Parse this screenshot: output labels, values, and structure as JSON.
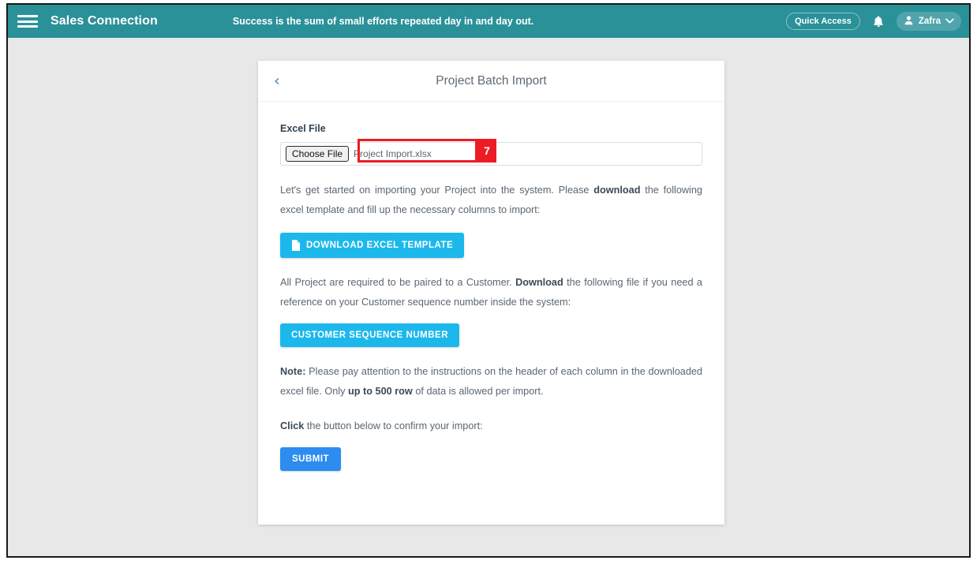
{
  "navbar": {
    "menu_icon": "hamburger-icon",
    "brand": "Sales Connection",
    "tagline": "Success is the sum of small efforts repeated day in and day out.",
    "quick_access_label": "Quick Access",
    "notification_icon": "bell-icon",
    "user_icon": "user-avatar-icon",
    "user_name": "Zafra",
    "user_caret_icon": "chevron-down-icon",
    "background_color": "#2b9199"
  },
  "card": {
    "back_icon": "chevron-left-icon",
    "title": "Project Batch Import"
  },
  "form": {
    "excel_file_label": "Excel File",
    "choose_file_button": "Choose File",
    "file_name": "Project Import.xlsx",
    "annotation_number": "7",
    "annotation_color": "#ed1c24"
  },
  "content": {
    "intro_part1": "Let's get started on importing your Project into the system. Please ",
    "intro_bold": "download",
    "intro_part2": " the following excel template and fill up the necessary columns to import:",
    "download_template_button": "DOWNLOAD EXCEL TEMPLATE",
    "download_template_icon": "file-document-icon",
    "customer_part1": "All Project are required to be paired to a Customer. ",
    "customer_bold": "Download",
    "customer_part2": " the following file if you need a reference on your Customer sequence number inside the system:",
    "customer_sequence_button": "CUSTOMER SEQUENCE NUMBER",
    "note_bold": "Note:",
    "note_part1": " Please pay attention to the instructions on the header of each column in the downloaded excel file. Only ",
    "note_bold2": "up to 500 row",
    "note_part2": " of data is allowed per import.",
    "click_bold": "Click",
    "click_rest": " the button below to confirm your import:",
    "submit_button": "SUBMIT"
  },
  "colors": {
    "cyan_button": "#1cb8ec",
    "blue_button": "#2d8cf0",
    "page_background": "#e8e8e8"
  }
}
